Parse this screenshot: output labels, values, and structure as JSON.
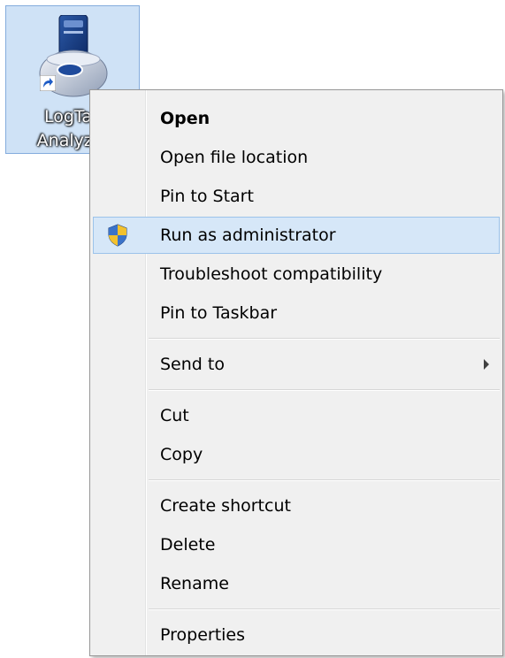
{
  "desktop_icon": {
    "label": "LogTag\nAnalyzer",
    "icon": "logtag-analyzer-shortcut-icon",
    "overlay_icon": "shortcut-arrow-icon"
  },
  "context_menu": {
    "items": [
      {
        "label": "Open",
        "bold": true
      },
      {
        "label": "Open file location"
      },
      {
        "label": "Pin to Start"
      },
      {
        "label": "Run as administrator",
        "icon": "uac-shield-icon",
        "highlighted": true
      },
      {
        "label": "Troubleshoot compatibility"
      },
      {
        "label": "Pin to Taskbar"
      },
      {
        "label": "Send to",
        "submenu": true
      },
      {
        "label": "Cut"
      },
      {
        "label": "Copy"
      },
      {
        "label": "Create shortcut"
      },
      {
        "label": "Delete"
      },
      {
        "label": "Rename"
      },
      {
        "label": "Properties"
      }
    ]
  },
  "colors": {
    "selection_fill": "#cfe2f6",
    "selection_border": "#84acdd",
    "hover_fill": "#d6e7f8",
    "hover_border": "#9cc3ea",
    "menu_background": "#f0f0f0"
  }
}
